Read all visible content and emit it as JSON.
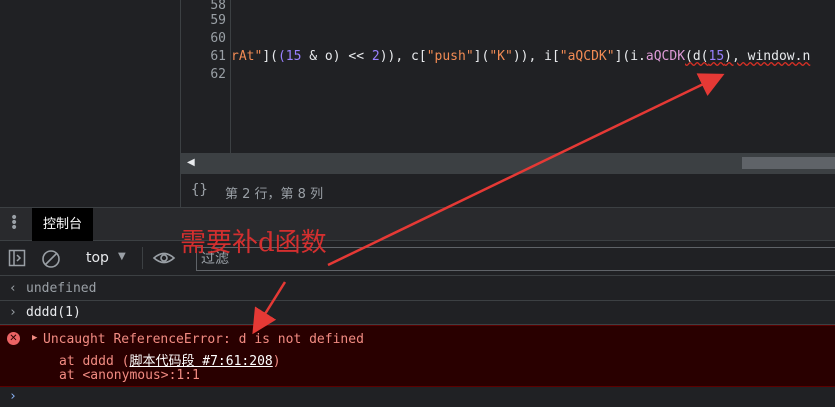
{
  "editor": {
    "line_numbers": [
      "58",
      "59",
      "60",
      "61",
      "62"
    ],
    "code": {
      "p1": "rAt\"",
      "p2": "](",
      "p3": "(15",
      "p4": " & o) << ",
      "p5": "2",
      "p6": ")), c[",
      "p7": "\"push\"",
      "p8": "](",
      "p9": "\"K\"",
      "p10": ")), i[",
      "p11": "\"aQCDK\"",
      "p12": "](i.",
      "p13": "aQCDK",
      "p14": "(d(",
      "p15": "15",
      "p16": "), window.n"
    }
  },
  "status": {
    "braces_icon": "{}",
    "cursor_position": "第 2 行，第 8 列"
  },
  "drawer": {
    "tab_console": "控制台"
  },
  "toolbar": {
    "context": "top",
    "filter_placeholder": "过滤"
  },
  "annotation": {
    "text": "需要补d函数",
    "color": "#d32f2f"
  },
  "console": {
    "result_glyph": "‹",
    "result_text": "undefined",
    "input_glyph": "›",
    "input_text": "dddd(1)",
    "error_message": "Uncaught ReferenceError: d is not defined",
    "error_at1_prefix": "at dddd (",
    "error_at1_link": "脚本代码段 #7:61:208",
    "error_at1_suffix": ")",
    "error_at2": "at <anonymous>:1:1",
    "prompt_glyph": "›"
  },
  "colors": {
    "error_bg": "#290000",
    "error_text": "#f28b82",
    "arrow": "#e53935"
  }
}
